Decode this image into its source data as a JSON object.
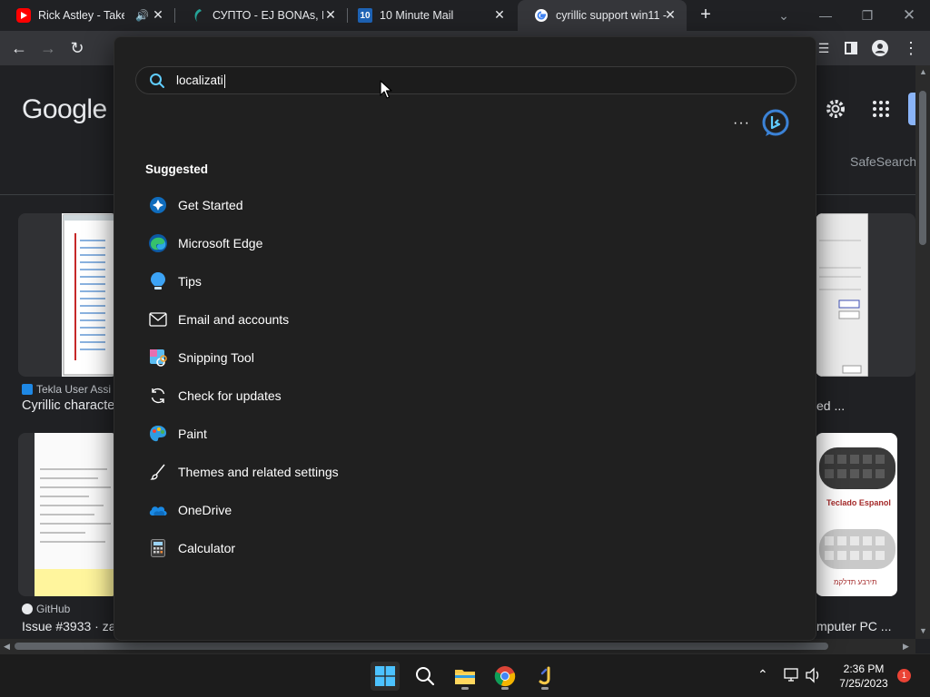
{
  "browser": {
    "tabs": [
      {
        "title": "Rick Astley - Take I",
        "favicon": "youtube-icon",
        "muted_icon": "speaker-icon"
      },
      {
        "title": "СУПТО - EJ BONAs, Пр",
        "favicon": "bonas-icon"
      },
      {
        "title": "10 Minute Mail",
        "favicon": "10-icon",
        "favicon_text": "10"
      },
      {
        "title": "cyrillic support win11 -",
        "favicon": "google-icon",
        "active": true
      }
    ],
    "new_tab_label": "+",
    "close_glyph": "✕"
  },
  "page": {
    "logo_text": "Google",
    "safesearch_label": "SafeSearch",
    "results": [
      {
        "source": "Tekla User Assi",
        "title": "Cyrillic characte"
      },
      {
        "source": "",
        "title": "ed ..."
      },
      {
        "source": "GitHub",
        "title": "Issue #3933 · za"
      },
      {
        "source": "",
        "title": "mputer PC ..."
      }
    ],
    "keyboard_caption": "Teclado Espanol",
    "keyboard_caption2": "תירבע תדלקמ"
  },
  "start_menu": {
    "search_value": "localizati",
    "more_label": "···",
    "suggested_heading": "Suggested",
    "items": [
      {
        "label": "Get Started",
        "icon": "get-started-icon"
      },
      {
        "label": "Microsoft Edge",
        "icon": "edge-icon"
      },
      {
        "label": "Tips",
        "icon": "tips-icon"
      },
      {
        "label": "Email and accounts",
        "icon": "mail-icon"
      },
      {
        "label": "Snipping Tool",
        "icon": "snipping-tool-icon"
      },
      {
        "label": "Check for updates",
        "icon": "refresh-icon"
      },
      {
        "label": "Paint",
        "icon": "paint-icon"
      },
      {
        "label": "Themes and related settings",
        "icon": "brush-icon"
      },
      {
        "label": "OneDrive",
        "icon": "onedrive-icon"
      },
      {
        "label": "Calculator",
        "icon": "calculator-icon"
      }
    ]
  },
  "taskbar": {
    "time": "2:36 PM",
    "date": "7/25/2023",
    "notification_count": "1"
  },
  "colors": {
    "accent_blue": "#60cdff",
    "windows_blue": "#0078d4",
    "badge_red": "#ea4335"
  }
}
